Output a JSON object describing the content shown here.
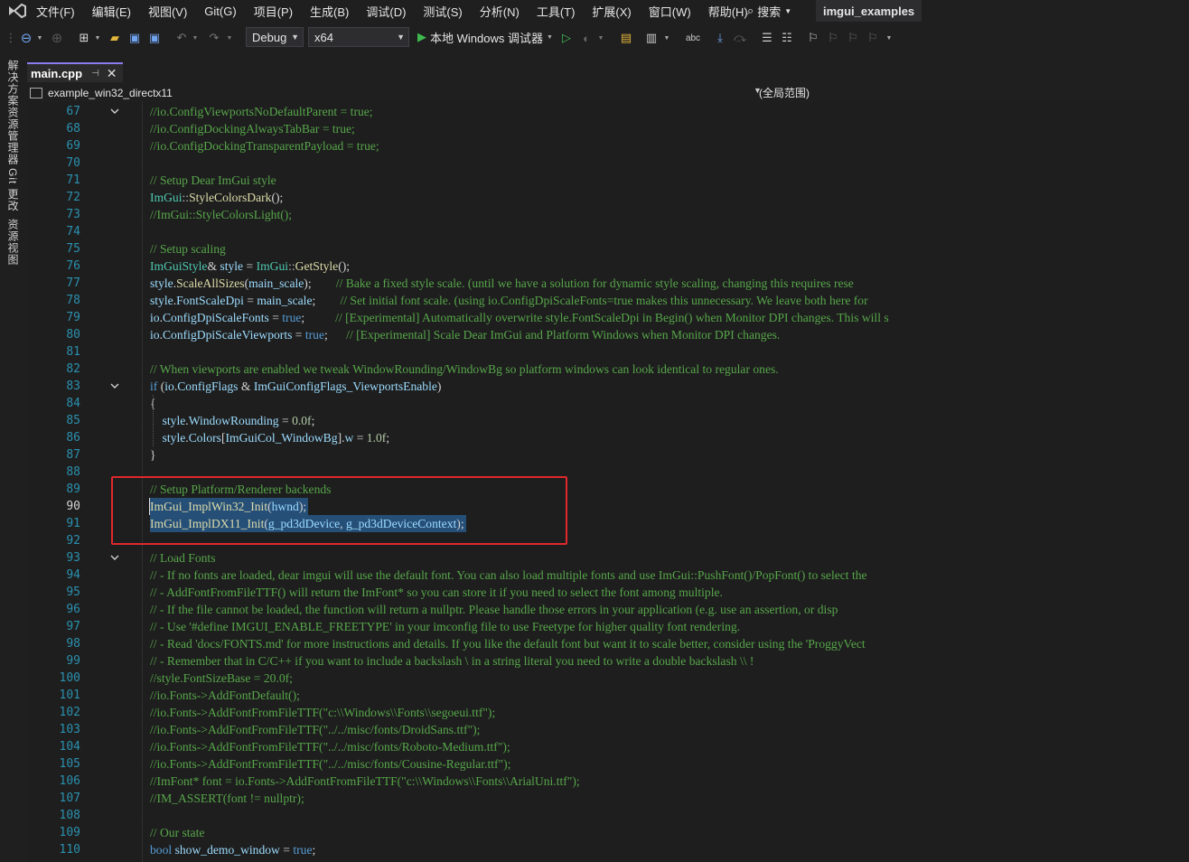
{
  "menubar": {
    "items": [
      "文件(F)",
      "编辑(E)",
      "视图(V)",
      "Git(G)",
      "项目(P)",
      "生成(B)",
      "调试(D)",
      "测试(S)",
      "分析(N)",
      "工具(T)",
      "扩展(X)",
      "窗口(W)",
      "帮助(H)"
    ],
    "search_label": "搜索",
    "project_name": "imgui_examples"
  },
  "toolbar": {
    "config": "Debug",
    "platform": "x64",
    "run_label": "本地 Windows 调试器"
  },
  "sidebar": {
    "tabs": [
      "解决方案资源管理器",
      "Git 更改",
      "资源视图"
    ]
  },
  "document_tab": {
    "filename": "main.cpp"
  },
  "navbar": {
    "project": "example_win32_directx11",
    "scope": "(全局范围)"
  },
  "editor": {
    "current_line": 90,
    "colors": {
      "comment": "#57a64a",
      "keyword": "#569cd6",
      "type": "#4ec9b0",
      "function": "#dcdcaa",
      "variable": "#9cdcfe",
      "selection": "#264f78",
      "highlight_box": "#e0282d"
    },
    "lines": [
      {
        "n": "67",
        "fold": true,
        "tokens": [
          [
            "c",
            "//io.ConfigViewportsNoDefaultParent = true;"
          ]
        ]
      },
      {
        "n": "68",
        "tokens": [
          [
            "c",
            "//io.ConfigDockingAlwaysTabBar = true;"
          ]
        ]
      },
      {
        "n": "69",
        "tokens": [
          [
            "c",
            "//io.ConfigDockingTransparentPayload = true;"
          ]
        ]
      },
      {
        "n": "70",
        "tokens": []
      },
      {
        "n": "71",
        "tokens": [
          [
            "c",
            "// Setup Dear ImGui style"
          ]
        ]
      },
      {
        "n": "72",
        "tokens": [
          [
            "t",
            "ImGui"
          ],
          [
            "p",
            "::"
          ],
          [
            "f",
            "StyleColorsDark"
          ],
          [
            "m",
            "();"
          ]
        ]
      },
      {
        "n": "73",
        "tokens": [
          [
            "c",
            "//ImGui::StyleColorsLight();"
          ]
        ]
      },
      {
        "n": "74",
        "tokens": []
      },
      {
        "n": "75",
        "tokens": [
          [
            "c",
            "// Setup scaling"
          ]
        ]
      },
      {
        "n": "76",
        "tokens": [
          [
            "t",
            "ImGuiStyle"
          ],
          [
            "m",
            "& "
          ],
          [
            "v",
            "style"
          ],
          [
            "m",
            " = "
          ],
          [
            "t",
            "ImGui"
          ],
          [
            "p",
            "::"
          ],
          [
            "f",
            "GetStyle"
          ],
          [
            "m",
            "();"
          ]
        ]
      },
      {
        "n": "77",
        "tokens": [
          [
            "v",
            "style"
          ],
          [
            "m",
            "."
          ],
          [
            "f",
            "ScaleAllSizes"
          ],
          [
            "m",
            "("
          ],
          [
            "v",
            "main_scale"
          ],
          [
            "m",
            ");        "
          ],
          [
            "c",
            "// Bake a fixed style scale. (until we have a solution for dynamic style scaling, changing this requires rese"
          ]
        ]
      },
      {
        "n": "78",
        "tokens": [
          [
            "v",
            "style"
          ],
          [
            "m",
            "."
          ],
          [
            "v",
            "FontScaleDpi"
          ],
          [
            "m",
            " = "
          ],
          [
            "v",
            "main_scale"
          ],
          [
            "m",
            ";        "
          ],
          [
            "c",
            "// Set initial font scale. (using io.ConfigDpiScaleFonts=true makes this unnecessary. We leave both here for"
          ]
        ]
      },
      {
        "n": "79",
        "tokens": [
          [
            "v",
            "io"
          ],
          [
            "m",
            "."
          ],
          [
            "v",
            "ConfigDpiScaleFonts"
          ],
          [
            "m",
            " = "
          ],
          [
            "k",
            "true"
          ],
          [
            "m",
            ";          "
          ],
          [
            "c",
            "// [Experimental] Automatically overwrite style.FontScaleDpi in Begin() when Monitor DPI changes. This will s"
          ]
        ]
      },
      {
        "n": "80",
        "tokens": [
          [
            "v",
            "io"
          ],
          [
            "m",
            "."
          ],
          [
            "v",
            "ConfigDpiScaleViewports"
          ],
          [
            "m",
            " = "
          ],
          [
            "k",
            "true"
          ],
          [
            "m",
            ";      "
          ],
          [
            "c",
            "// [Experimental] Scale Dear ImGui and Platform Windows when Monitor DPI changes."
          ]
        ]
      },
      {
        "n": "81",
        "tokens": []
      },
      {
        "n": "82",
        "tokens": [
          [
            "c",
            "// When viewports are enabled we tweak WindowRounding/WindowBg so platform windows can look identical to regular ones."
          ]
        ]
      },
      {
        "n": "83",
        "fold": true,
        "tokens": [
          [
            "k",
            "if"
          ],
          [
            "m",
            " ("
          ],
          [
            "v",
            "io"
          ],
          [
            "m",
            "."
          ],
          [
            "v",
            "ConfigFlags"
          ],
          [
            "m",
            " & "
          ],
          [
            "v",
            "ImGuiConfigFlags_ViewportsEnable"
          ],
          [
            "m",
            ")"
          ]
        ]
      },
      {
        "n": "84",
        "tokens": [
          [
            "m",
            "{"
          ]
        ]
      },
      {
        "n": "85",
        "tokens": [
          [
            "m",
            "    "
          ],
          [
            "v",
            "style"
          ],
          [
            "m",
            "."
          ],
          [
            "v",
            "WindowRounding"
          ],
          [
            "m",
            " = "
          ],
          [
            "n",
            "0.0f"
          ],
          [
            "m",
            ";"
          ]
        ]
      },
      {
        "n": "86",
        "tokens": [
          [
            "m",
            "    "
          ],
          [
            "v",
            "style"
          ],
          [
            "m",
            "."
          ],
          [
            "v",
            "Colors"
          ],
          [
            "m",
            "["
          ],
          [
            "v",
            "ImGuiCol_WindowBg"
          ],
          [
            "m",
            "]."
          ],
          [
            "v",
            "w"
          ],
          [
            "m",
            " = "
          ],
          [
            "n",
            "1.0f"
          ],
          [
            "m",
            ";"
          ]
        ]
      },
      {
        "n": "87",
        "tokens": [
          [
            "m",
            "}"
          ]
        ]
      },
      {
        "n": "88",
        "tokens": []
      },
      {
        "n": "89",
        "tokens": [
          [
            "c",
            "// Setup Platform/Renderer backends"
          ]
        ]
      },
      {
        "n": "90",
        "sel": true,
        "tokens": [
          [
            "f",
            "ImGui_ImplWin32_Init"
          ],
          [
            "m",
            "("
          ],
          [
            "v",
            "hwnd"
          ],
          [
            "m",
            ");"
          ]
        ]
      },
      {
        "n": "91",
        "sel": true,
        "tokens": [
          [
            "f",
            "ImGui_ImplDX11_Init"
          ],
          [
            "m",
            "("
          ],
          [
            "v",
            "g_pd3dDevice"
          ],
          [
            "m",
            ", "
          ],
          [
            "v",
            "g_pd3dDeviceContext"
          ],
          [
            "m",
            ");"
          ]
        ]
      },
      {
        "n": "92",
        "tokens": []
      },
      {
        "n": "93",
        "fold": true,
        "tokens": [
          [
            "c",
            "// Load Fonts"
          ]
        ]
      },
      {
        "n": "94",
        "tokens": [
          [
            "c",
            "// - If no fonts are loaded, dear imgui will use the default font. You can also load multiple fonts and use ImGui::PushFont()/PopFont() to select the"
          ]
        ]
      },
      {
        "n": "95",
        "tokens": [
          [
            "c",
            "// - AddFontFromFileTTF() will return the ImFont* so you can store it if you need to select the font among multiple."
          ]
        ]
      },
      {
        "n": "96",
        "tokens": [
          [
            "c",
            "// - If the file cannot be loaded, the function will return a nullptr. Please handle those errors in your application (e.g. use an assertion, or disp"
          ]
        ]
      },
      {
        "n": "97",
        "tokens": [
          [
            "c",
            "// - Use '#define IMGUI_ENABLE_FREETYPE' in your imconfig file to use Freetype for higher quality font rendering."
          ]
        ]
      },
      {
        "n": "98",
        "tokens": [
          [
            "c",
            "// - Read 'docs/FONTS.md' for more instructions and details. If you like the default font but want it to scale better, consider using the 'ProggyVect"
          ]
        ]
      },
      {
        "n": "99",
        "tokens": [
          [
            "c",
            "// - Remember that in C/C++ if you want to include a backslash \\ in a string literal you need to write a double backslash \\\\ !"
          ]
        ]
      },
      {
        "n": "100",
        "tokens": [
          [
            "c",
            "//style.FontSizeBase = 20.0f;"
          ]
        ]
      },
      {
        "n": "101",
        "tokens": [
          [
            "c",
            "//io.Fonts->AddFontDefault();"
          ]
        ]
      },
      {
        "n": "102",
        "tokens": [
          [
            "c",
            "//io.Fonts->AddFontFromFileTTF(\"c:\\\\Windows\\\\Fonts\\\\segoeui.ttf\");"
          ]
        ]
      },
      {
        "n": "103",
        "tokens": [
          [
            "c",
            "//io.Fonts->AddFontFromFileTTF(\"../../misc/fonts/DroidSans.ttf\");"
          ]
        ]
      },
      {
        "n": "104",
        "tokens": [
          [
            "c",
            "//io.Fonts->AddFontFromFileTTF(\"../../misc/fonts/Roboto-Medium.ttf\");"
          ]
        ]
      },
      {
        "n": "105",
        "tokens": [
          [
            "c",
            "//io.Fonts->AddFontFromFileTTF(\"../../misc/fonts/Cousine-Regular.ttf\");"
          ]
        ]
      },
      {
        "n": "106",
        "tokens": [
          [
            "c",
            "//ImFont* font = io.Fonts->AddFontFromFileTTF(\"c:\\\\Windows\\\\Fonts\\\\ArialUni.ttf\");"
          ]
        ]
      },
      {
        "n": "107",
        "tokens": [
          [
            "c",
            "//IM_ASSERT(font != nullptr);"
          ]
        ]
      },
      {
        "n": "108",
        "tokens": []
      },
      {
        "n": "109",
        "tokens": [
          [
            "c",
            "// Our state"
          ]
        ]
      },
      {
        "n": "110",
        "tokens": [
          [
            "k",
            "bool"
          ],
          [
            "m",
            " "
          ],
          [
            "v",
            "show_demo_window"
          ],
          [
            "m",
            " = "
          ],
          [
            "k",
            "true"
          ],
          [
            "m",
            ";"
          ]
        ]
      }
    ]
  }
}
